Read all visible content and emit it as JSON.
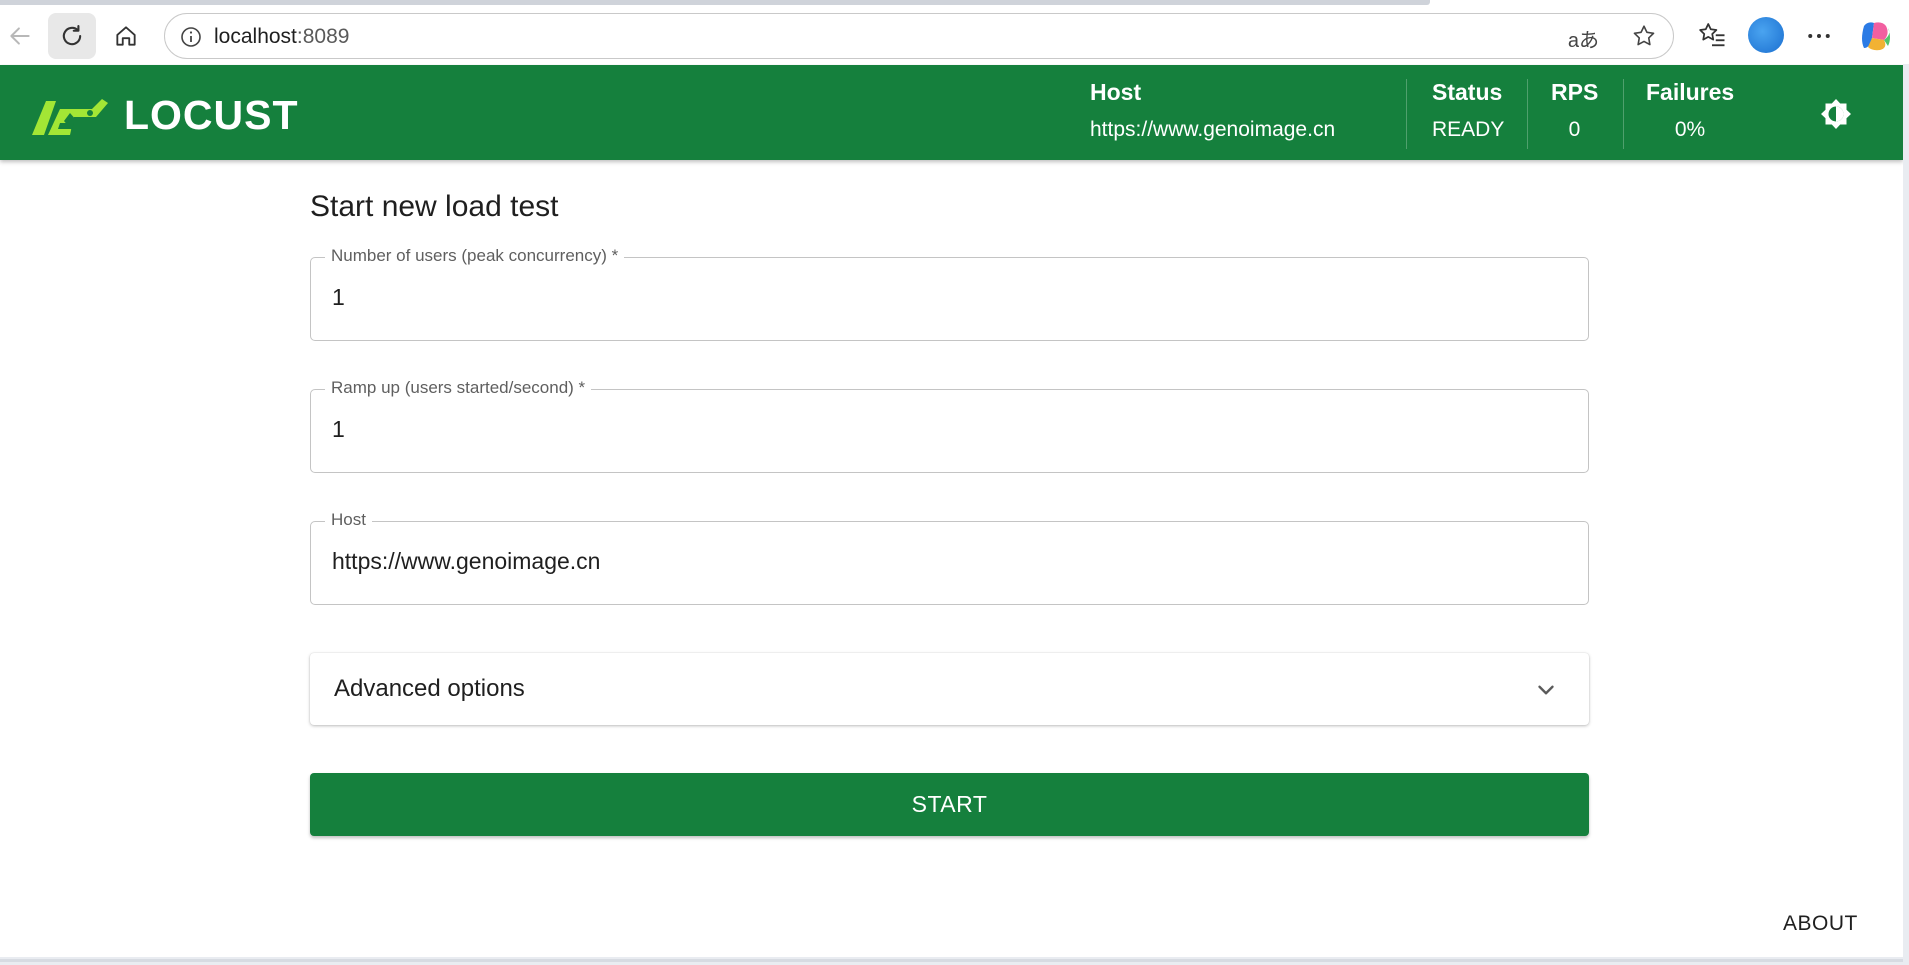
{
  "browser": {
    "url_host": "localhost",
    "url_port": ":8089",
    "read_aloud_glyph": "aあ"
  },
  "header": {
    "logo_text": "LOCUST",
    "host_label": "Host",
    "host_value": "https://www.genoimage.cn",
    "status_label": "Status",
    "status_value": "READY",
    "rps_label": "RPS",
    "rps_value": "0",
    "failures_label": "Failures",
    "failures_value": "0%"
  },
  "form": {
    "title": "Start new load test",
    "users_label": "Number of users (peak concurrency) *",
    "users_value": "1",
    "ramp_label": "Ramp up (users started/second) *",
    "ramp_value": "1",
    "host_label": "Host",
    "host_value": "https://www.genoimage.cn",
    "advanced_label": "Advanced options",
    "start_label": "START"
  },
  "footer": {
    "about_label": "ABOUT"
  },
  "colors": {
    "brand_green": "#15803d",
    "logo_lime": "#a3e635"
  },
  "icons": [
    "back-arrow-icon",
    "reload-icon",
    "home-icon",
    "info-icon",
    "star-icon",
    "favorites-icon",
    "more-icon",
    "copilot-icon",
    "locust-logo-icon",
    "theme-toggle-icon",
    "chevron-down-icon"
  ]
}
